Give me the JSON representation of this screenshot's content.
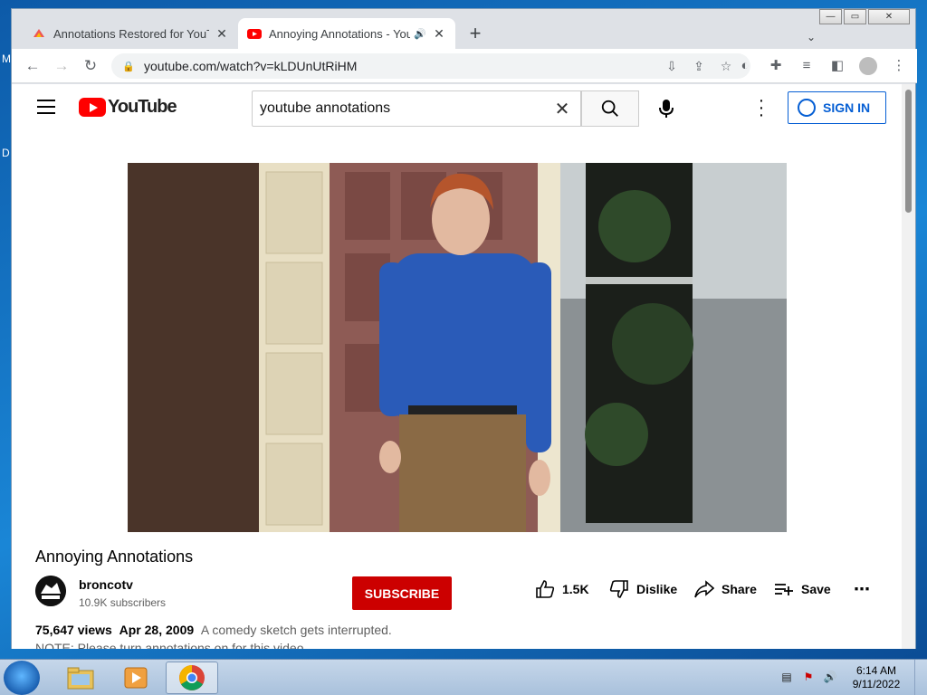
{
  "desktop": {
    "glyph_1": "M",
    "glyph_2": "D"
  },
  "browser": {
    "tabs": [
      {
        "title": "Annotations Restored for YouTube",
        "active": false
      },
      {
        "title": "Annoying Annotations - YouTube",
        "active": true
      }
    ],
    "new_tab": "+",
    "url": "youtube.com/watch?v=kLDUnUtRiHM"
  },
  "youtube": {
    "logo_text": "YouTube",
    "search_value": "youtube annotations",
    "search_placeholder": "Search",
    "sign_in": "SIGN IN",
    "video_title": "Annoying Annotations",
    "channel_name": "broncotv",
    "subscribers": "10.9K subscribers",
    "subscribe": "SUBSCRIBE",
    "likes": "1.5K",
    "dislike": "Dislike",
    "share": "Share",
    "save": "Save",
    "views": "75,647 views",
    "date": "Apr 28, 2009",
    "description_1": "A comedy sketch gets interrupted.",
    "description_2": "NOTE: Please turn annotations on for this video"
  },
  "taskbar": {
    "time": "6:14 AM",
    "date": "9/11/2022"
  },
  "colors": {
    "yt_red": "#ff0000",
    "subscribe_red": "#cc0000",
    "link_blue": "#065fd4"
  }
}
